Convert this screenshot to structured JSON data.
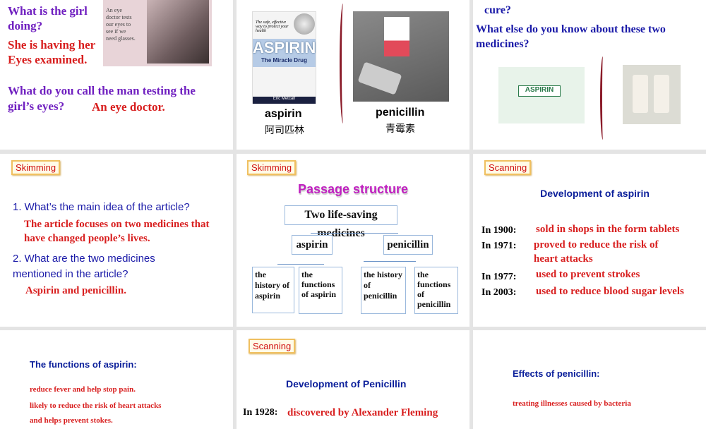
{
  "slides": [
    {
      "q1": "What is the girl doing?",
      "a1": "She is having her Eyes examined.",
      "caption": "An eye doctor tests our eyes to see if we need glasses.",
      "q2": "What do you call the man testing the girl’s eyes?",
      "a2": "An eye doctor."
    },
    {
      "book_tagline": "The safe, effective way to protect your health",
      "book_title": "ASPIRIN",
      "book_subtitle": "The Miracle Drug",
      "book_author": "Eric Metcalf",
      "left_en": "aspirin",
      "left_zh": "阿司匹林",
      "right_en": "penicillin",
      "right_zh": "青霉素"
    },
    {
      "q_top": "cure?",
      "q": "What else do you know about these two medicines?",
      "box_label": "ASPIRIN"
    },
    {
      "tag": "Skimming",
      "q1": "1. What’s the main idea of the article?",
      "a1": "The article focuses on two medicines that have changed people’s lives.",
      "q2": "2. What are the two medicines mentioned in the article?",
      "a2": "Aspirin and penicillin."
    },
    {
      "tag": "Skimming",
      "title": "Passage structure",
      "root": "Two life-saving medicines",
      "aspirin": "aspirin",
      "penicillin": "penicillin",
      "leaves": [
        "the history of aspirin",
        "the functions of aspirin",
        "the history of penicillin",
        "the functions of penicillin"
      ]
    },
    {
      "tag": "Scanning",
      "title": "Development of aspirin",
      "rows": [
        {
          "year": "In 1900:",
          "text": "sold in shops in the form tablets"
        },
        {
          "year": "In 1971:",
          "text": "proved to reduce the risk of heart attacks"
        },
        {
          "year": "In 1977:",
          "text": "used to prevent strokes"
        },
        {
          "year": "In 2003:",
          "text": "used to reduce blood sugar levels"
        }
      ]
    },
    {
      "title": "The functions of aspirin:",
      "l1": "reduce fever and help stop pain.",
      "l2": "likely to reduce the risk of heart attacks",
      "l3": "and helps prevent stokes."
    },
    {
      "tag": "Scanning",
      "title": "Development of Penicillin",
      "year": "In 1928:",
      "text": "discovered by Alexander Fleming"
    },
    {
      "title": "Effects of penicillin:",
      "l1": "treating illnesses caused by bacteria"
    }
  ]
}
